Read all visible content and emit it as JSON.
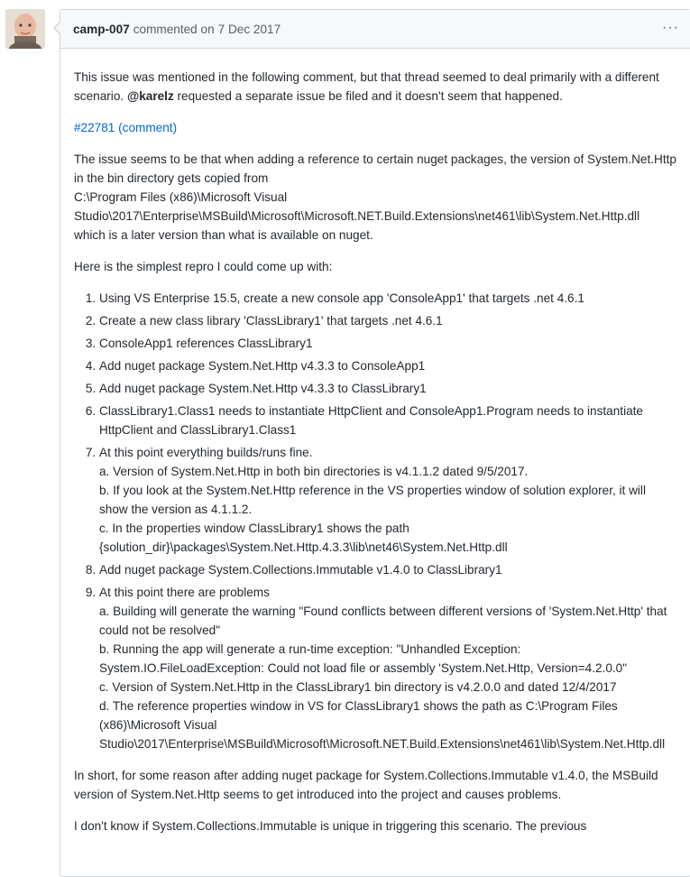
{
  "comment": {
    "author": "camp-007",
    "action": "commented on",
    "date": "7 Dec 2017",
    "menu_icon": "kebab-horizontal-icon"
  },
  "intro": {
    "line1": "This issue was mentioned in the following comment, but that thread seemed to deal primarily with a different scenario. ",
    "mention": "@karelz",
    "line2": " requested a separate issue be filed and it doesn't seem that happened."
  },
  "ref_link": "#22781 (comment)",
  "paragraph2": "The issue seems to be that when adding a reference to certain nuget packages, the version of System.Net.Http in the bin directory gets copied from",
  "path1": "C:\\Program Files (x86)\\Microsoft Visual Studio\\2017\\Enterprise\\MSBuild\\Microsoft\\Microsoft.NET.Build.Extensions\\net461\\lib\\System.Net.Http.dll",
  "path1_tail": "which is a later version than what is available on nuget.",
  "paragraph3": "Here is the simplest repro I could come up with:",
  "steps": [
    "Using VS Enterprise 15.5, create a new console app 'ConsoleApp1' that targets .net 4.6.1",
    "Create a new class library 'ClassLibrary1' that targets .net 4.6.1",
    "ConsoleApp1 references ClassLibrary1",
    "Add nuget package System.Net.Http v4.3.3 to ConsoleApp1",
    "Add nuget package System.Net.Http v4.3.3 to ClassLibrary1",
    "ClassLibrary1.Class1 needs to instantiate HttpClient and ConsoleApp1.Program needs to instantiate HttpClient and ClassLibrary1.Class1",
    "At this point everything builds/runs fine.",
    "Add nuget package System.Collections.Immutable v1.4.0 to ClassLibrary1",
    "At this point there are problems"
  ],
  "step7_sub": [
    "a. Version of System.Net.Http in both bin directories is v4.1.1.2 dated 9/5/2017.",
    "b. If you look at the System.Net.Http reference in the VS properties window of solution explorer, it will show the version as 4.1.1.2.",
    "c. In the properties window ClassLibrary1 shows the path",
    "{solution_dir}\\packages\\System.Net.Http.4.3.3\\lib\\net46\\System.Net.Http.dll"
  ],
  "step9_sub": [
    "a. Building will generate the warning \"Found conflicts between different versions of 'System.Net.Http' that could not be resolved\"",
    "b. Running the app will generate a run-time exception: \"Unhandled Exception:",
    "System.IO.FileLoadException: Could not load file or assembly 'System.Net.Http, Version=4.2.0.0\"",
    "c. Version of System.Net.Http in the ClassLibrary1 bin directory is v4.2.0.0 and dated 12/4/2017",
    "d. The reference properties window in VS for ClassLibrary1 shows the path as C:\\Program Files (x86)\\Microsoft Visual Studio\\2017\\Enterprise\\MSBuild\\Microsoft\\Microsoft.NET.Build.Extensions\\net461\\lib\\System.Net.Http.dll"
  ],
  "paragraph4": "In short, for some reason after adding nuget package for System.Collections.Immutable v1.4.0, the MSBuild version of System.Net.Http seems to get introduced into the project and causes problems.",
  "paragraph5": "I don't know if System.Collections.Immutable is unique in triggering this scenario. The previous"
}
